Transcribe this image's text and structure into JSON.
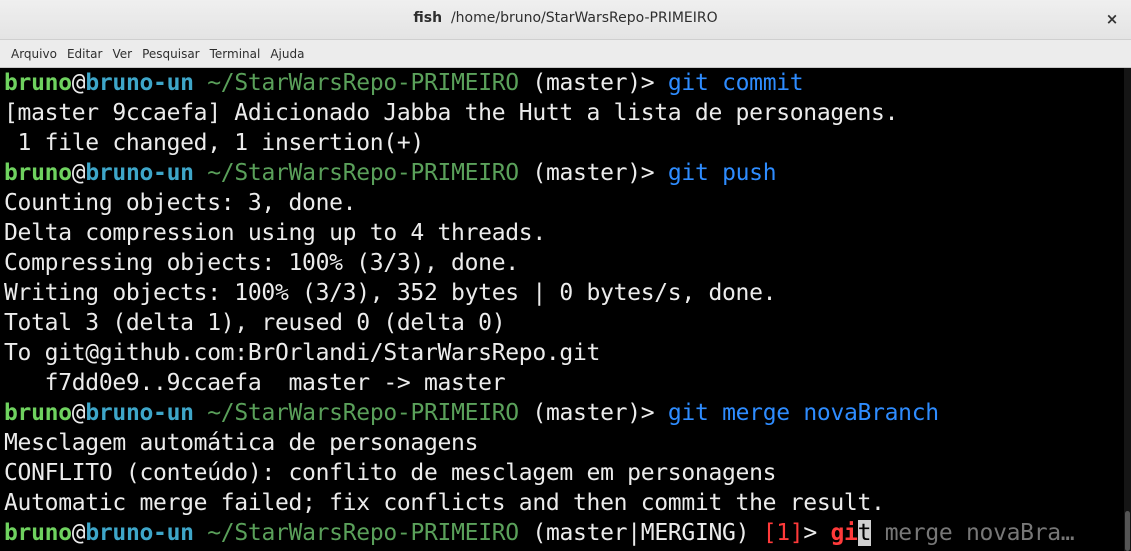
{
  "window": {
    "title_app": "fish",
    "title_path": "/home/bruno/StarWarsRepo-PRIMEIRO",
    "close_glyph": "×"
  },
  "menu": [
    "Arquivo",
    "Editar",
    "Ver",
    "Pesquisar",
    "Terminal",
    "Ajuda"
  ],
  "prompt": {
    "user": "bruno",
    "at": "@",
    "host": "bruno-un",
    "path": " ~/StarWarsRepo-PRIMEIRO",
    "branch": " (master)> ",
    "branch_merging": " (master|MERGING) ",
    "status": "[1]",
    "arrow": "> "
  },
  "lines": {
    "l1_cmd": "git commit",
    "l2": "[master 9ccaefa] Adicionado Jabba the Hutt a lista de personagens.",
    "l3": " 1 file changed, 1 insertion(+)",
    "l4_cmd": "git push",
    "l5": "Counting objects: 3, done.",
    "l6": "Delta compression using up to 4 threads.",
    "l7": "Compressing objects: 100% (3/3), done.",
    "l8": "Writing objects: 100% (3/3), 352 bytes | 0 bytes/s, done.",
    "l9": "Total 3 (delta 1), reused 0 (delta 0)",
    "l10": "To git@github.com:BrOrlandi/StarWarsRepo.git",
    "l11": "   f7dd0e9..9ccaefa  master -> master",
    "l12_cmd": "git merge novaBranch",
    "l13": "Mesclagem automática de personagens",
    "l14": "CONFLITO (conteúdo): conflito de mesclagem em personagens",
    "l15": "Automatic merge failed; fix conflicts and then commit the result.",
    "l16_typed": "gi",
    "l16_cursor": "t",
    "l16_suggestion": " merge novaBra…"
  }
}
